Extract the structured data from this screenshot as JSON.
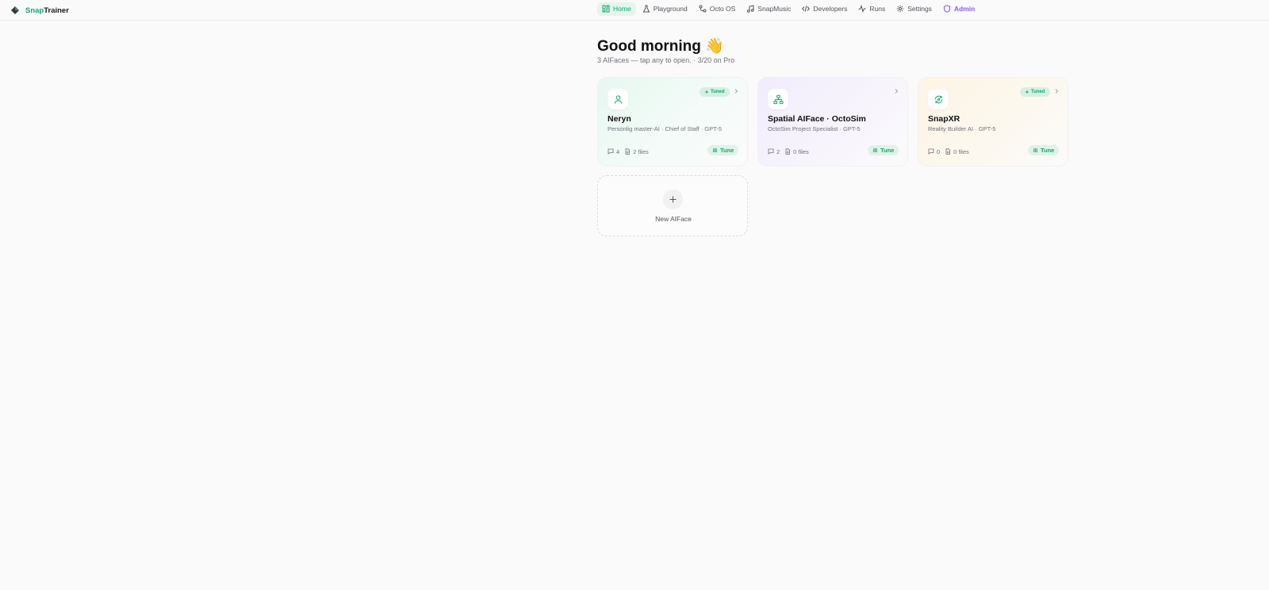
{
  "brand": {
    "part1": "Snap",
    "part2": "Trainer"
  },
  "nav": {
    "items": [
      {
        "label": "Home",
        "icon": "grid-icon"
      },
      {
        "label": "Playground",
        "icon": "flask-icon"
      },
      {
        "label": "Octo OS",
        "icon": "route-icon"
      },
      {
        "label": "SnapMusic",
        "icon": "music-icon"
      },
      {
        "label": "Developers",
        "icon": "code-icon"
      },
      {
        "label": "Runs",
        "icon": "activity-icon"
      },
      {
        "label": "Settings",
        "icon": "gear-icon"
      },
      {
        "label": "Admin",
        "icon": "shield-icon"
      }
    ],
    "active": "Home"
  },
  "main": {
    "greeting": "Good morning 👋",
    "subtitle": "3 AIFaces — tap any to open. · 3/20 on Pro"
  },
  "cards": [
    {
      "name": "Neryn",
      "role": "Personlig master-AI · Chief of Staff · GPT-5",
      "badge": "Tuned",
      "chats": "4",
      "files": "2 files",
      "tune": "Tune",
      "icon": "user-icon"
    },
    {
      "name": "Spatial AIFace · OctoSim",
      "role": "OctoSim Project Specialist · GPT-5",
      "badge": "",
      "chats": "2",
      "files": "0 files",
      "tune": "Tune",
      "icon": "network-icon"
    },
    {
      "name": "SnapXR",
      "role": "Reality Builder AI · GPT-5",
      "badge": "Tuned",
      "chats": "0",
      "files": "0 files",
      "tune": "Tune",
      "icon": "cycle-icon"
    }
  ],
  "new_card": {
    "label": "New AIFace"
  },
  "colors": {
    "accent": "#10a86b",
    "admin": "#8b5cf6",
    "background": "#fafafa"
  }
}
